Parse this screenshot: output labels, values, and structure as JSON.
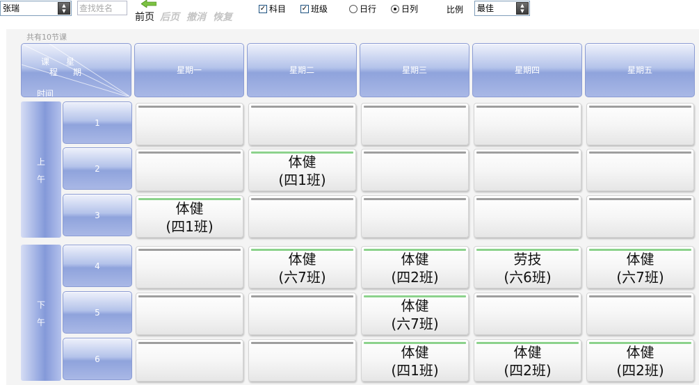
{
  "toolbar": {
    "teacher_select": "张瑞",
    "search_placeholder": "查找姓名",
    "nav": [
      "前页",
      "后页",
      "撤消",
      "恢复"
    ],
    "checkboxes": [
      {
        "label": "科目",
        "checked": true
      },
      {
        "label": "班级",
        "checked": true
      }
    ],
    "radios": [
      {
        "label": "日行",
        "selected": false
      },
      {
        "label": "日列",
        "selected": true
      }
    ],
    "ratio_label": "比例",
    "ratio_select": "最佳"
  },
  "lesson_count": "共有10节课",
  "corner": {
    "course": "课",
    "cheng": "程",
    "star": "星",
    "qi": "期",
    "time": "时间"
  },
  "days": [
    "星期一",
    "星期二",
    "星期三",
    "星期四",
    "星期五"
  ],
  "sessions": [
    {
      "label_top": "上",
      "label_bottom": "午"
    },
    {
      "label_top": "下",
      "label_bottom": "午"
    }
  ],
  "periods": [
    "1",
    "2",
    "3",
    "4",
    "5",
    "6"
  ],
  "timetable": [
    [
      null,
      null,
      null,
      null,
      null
    ],
    [
      null,
      {
        "subject": "体健",
        "class": "(四1班)"
      },
      null,
      null,
      null
    ],
    [
      {
        "subject": "体健",
        "class": "(四1班)"
      },
      null,
      null,
      null,
      null
    ],
    [
      null,
      {
        "subject": "体健",
        "class": "(六7班)"
      },
      {
        "subject": "体健",
        "class": "(四2班)"
      },
      {
        "subject": "劳技",
        "class": "(六6班)"
      },
      {
        "subject": "体健",
        "class": "(六7班)"
      }
    ],
    [
      null,
      null,
      {
        "subject": "体健",
        "class": "(六7班)"
      },
      null,
      null
    ],
    [
      null,
      null,
      {
        "subject": "体健",
        "class": "(四1班)"
      },
      {
        "subject": "体健",
        "class": "(四2班)"
      },
      {
        "subject": "体健",
        "class": "(四2班)"
      }
    ]
  ],
  "colors": {
    "header_blue": "#8fa3dc",
    "filled_bar": "#8cd28c",
    "empty_bar": "#9e9e9e"
  }
}
